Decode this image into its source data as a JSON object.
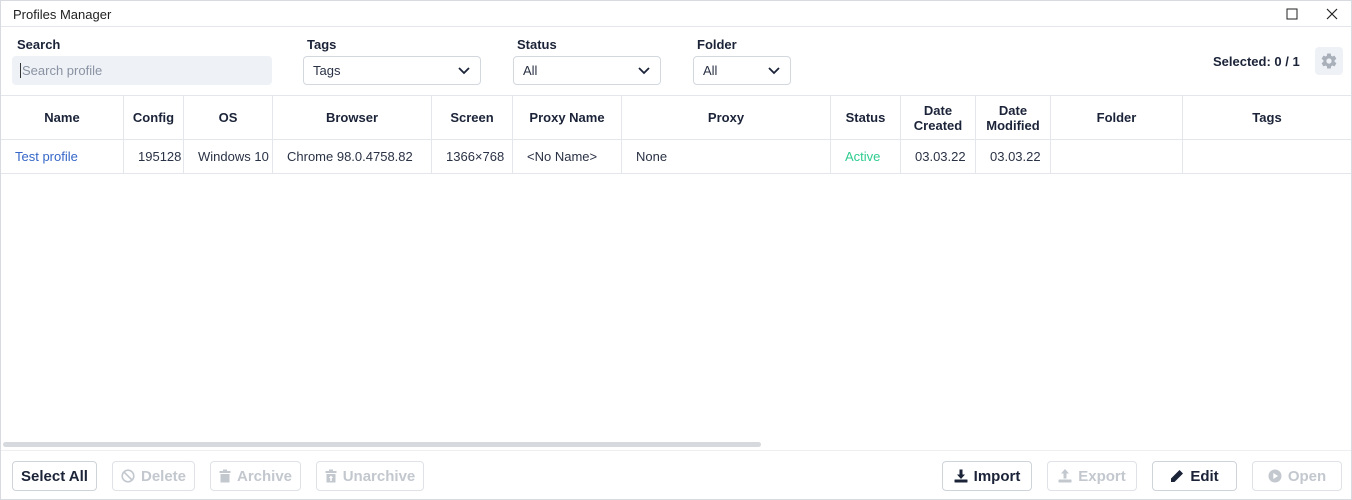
{
  "window": {
    "title": "Profiles Manager"
  },
  "filters": {
    "search_label": "Search",
    "search_placeholder": "Search profile",
    "tags_label": "Tags",
    "tags_value": "Tags",
    "status_label": "Status",
    "status_value": "All",
    "folder_label": "Folder",
    "folder_value": "All",
    "selected_text": "Selected: 0 / 1"
  },
  "table": {
    "columns": {
      "name": "Name",
      "config": "Config",
      "os": "OS",
      "browser": "Browser",
      "screen": "Screen",
      "proxy_name": "Proxy Name",
      "proxy": "Proxy",
      "status": "Status",
      "date_created": "Date Created",
      "date_modified": "Date Modified",
      "folder": "Folder",
      "tags": "Tags"
    },
    "rows": [
      {
        "name": "Test profile",
        "config": "195128",
        "os": "Windows 10",
        "browser": "Chrome 98.0.4758.82",
        "screen": "1366×768",
        "proxy_name": "<No Name>",
        "proxy": "None",
        "status": "Active",
        "date_created": "03.03.22",
        "date_modified": "03.03.22",
        "folder": "",
        "tags": ""
      }
    ]
  },
  "footer": {
    "select_all": "Select All",
    "delete": "Delete",
    "archive": "Archive",
    "unarchive": "Unarchive",
    "import": "Import",
    "export": "Export",
    "edit": "Edit",
    "open": "Open"
  },
  "colors": {
    "link": "#3566c8",
    "active_status": "#2ecc8f",
    "disabled": "#c3c8cf"
  }
}
